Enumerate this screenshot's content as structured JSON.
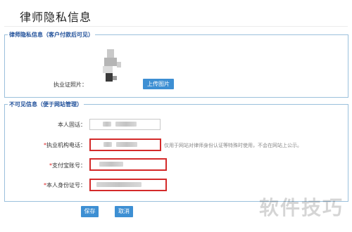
{
  "page": {
    "title": "律师隐私信息"
  },
  "section_private": {
    "legend": "律师隐私信息（客户付款后可见）",
    "photo_label": "执业证照片：",
    "upload_button": "上传图片"
  },
  "section_invisible": {
    "legend": "不可见信息（便于网站管理）",
    "fields": [
      {
        "required": false,
        "label": "本人固话：",
        "value": "",
        "invalid": false
      },
      {
        "required": true,
        "label": "执业机构电话：",
        "value": "",
        "invalid": true
      },
      {
        "required": true,
        "label": "支付宝账号：",
        "value": "",
        "invalid": true
      },
      {
        "required": true,
        "label": "本人身份证号：",
        "value": "",
        "invalid": true
      }
    ],
    "required_mark": "*",
    "hint": "仅用于网站对律师身份认证等特殊时使用，不会在网站上公示。"
  },
  "actions": {
    "save": "保存",
    "cancel": "取消"
  },
  "watermark": "软件技巧",
  "colors": {
    "accent": "#3d8fd3",
    "border": "#9bc0dc",
    "error": "#d42a2a",
    "legend": "#1f4f99"
  }
}
